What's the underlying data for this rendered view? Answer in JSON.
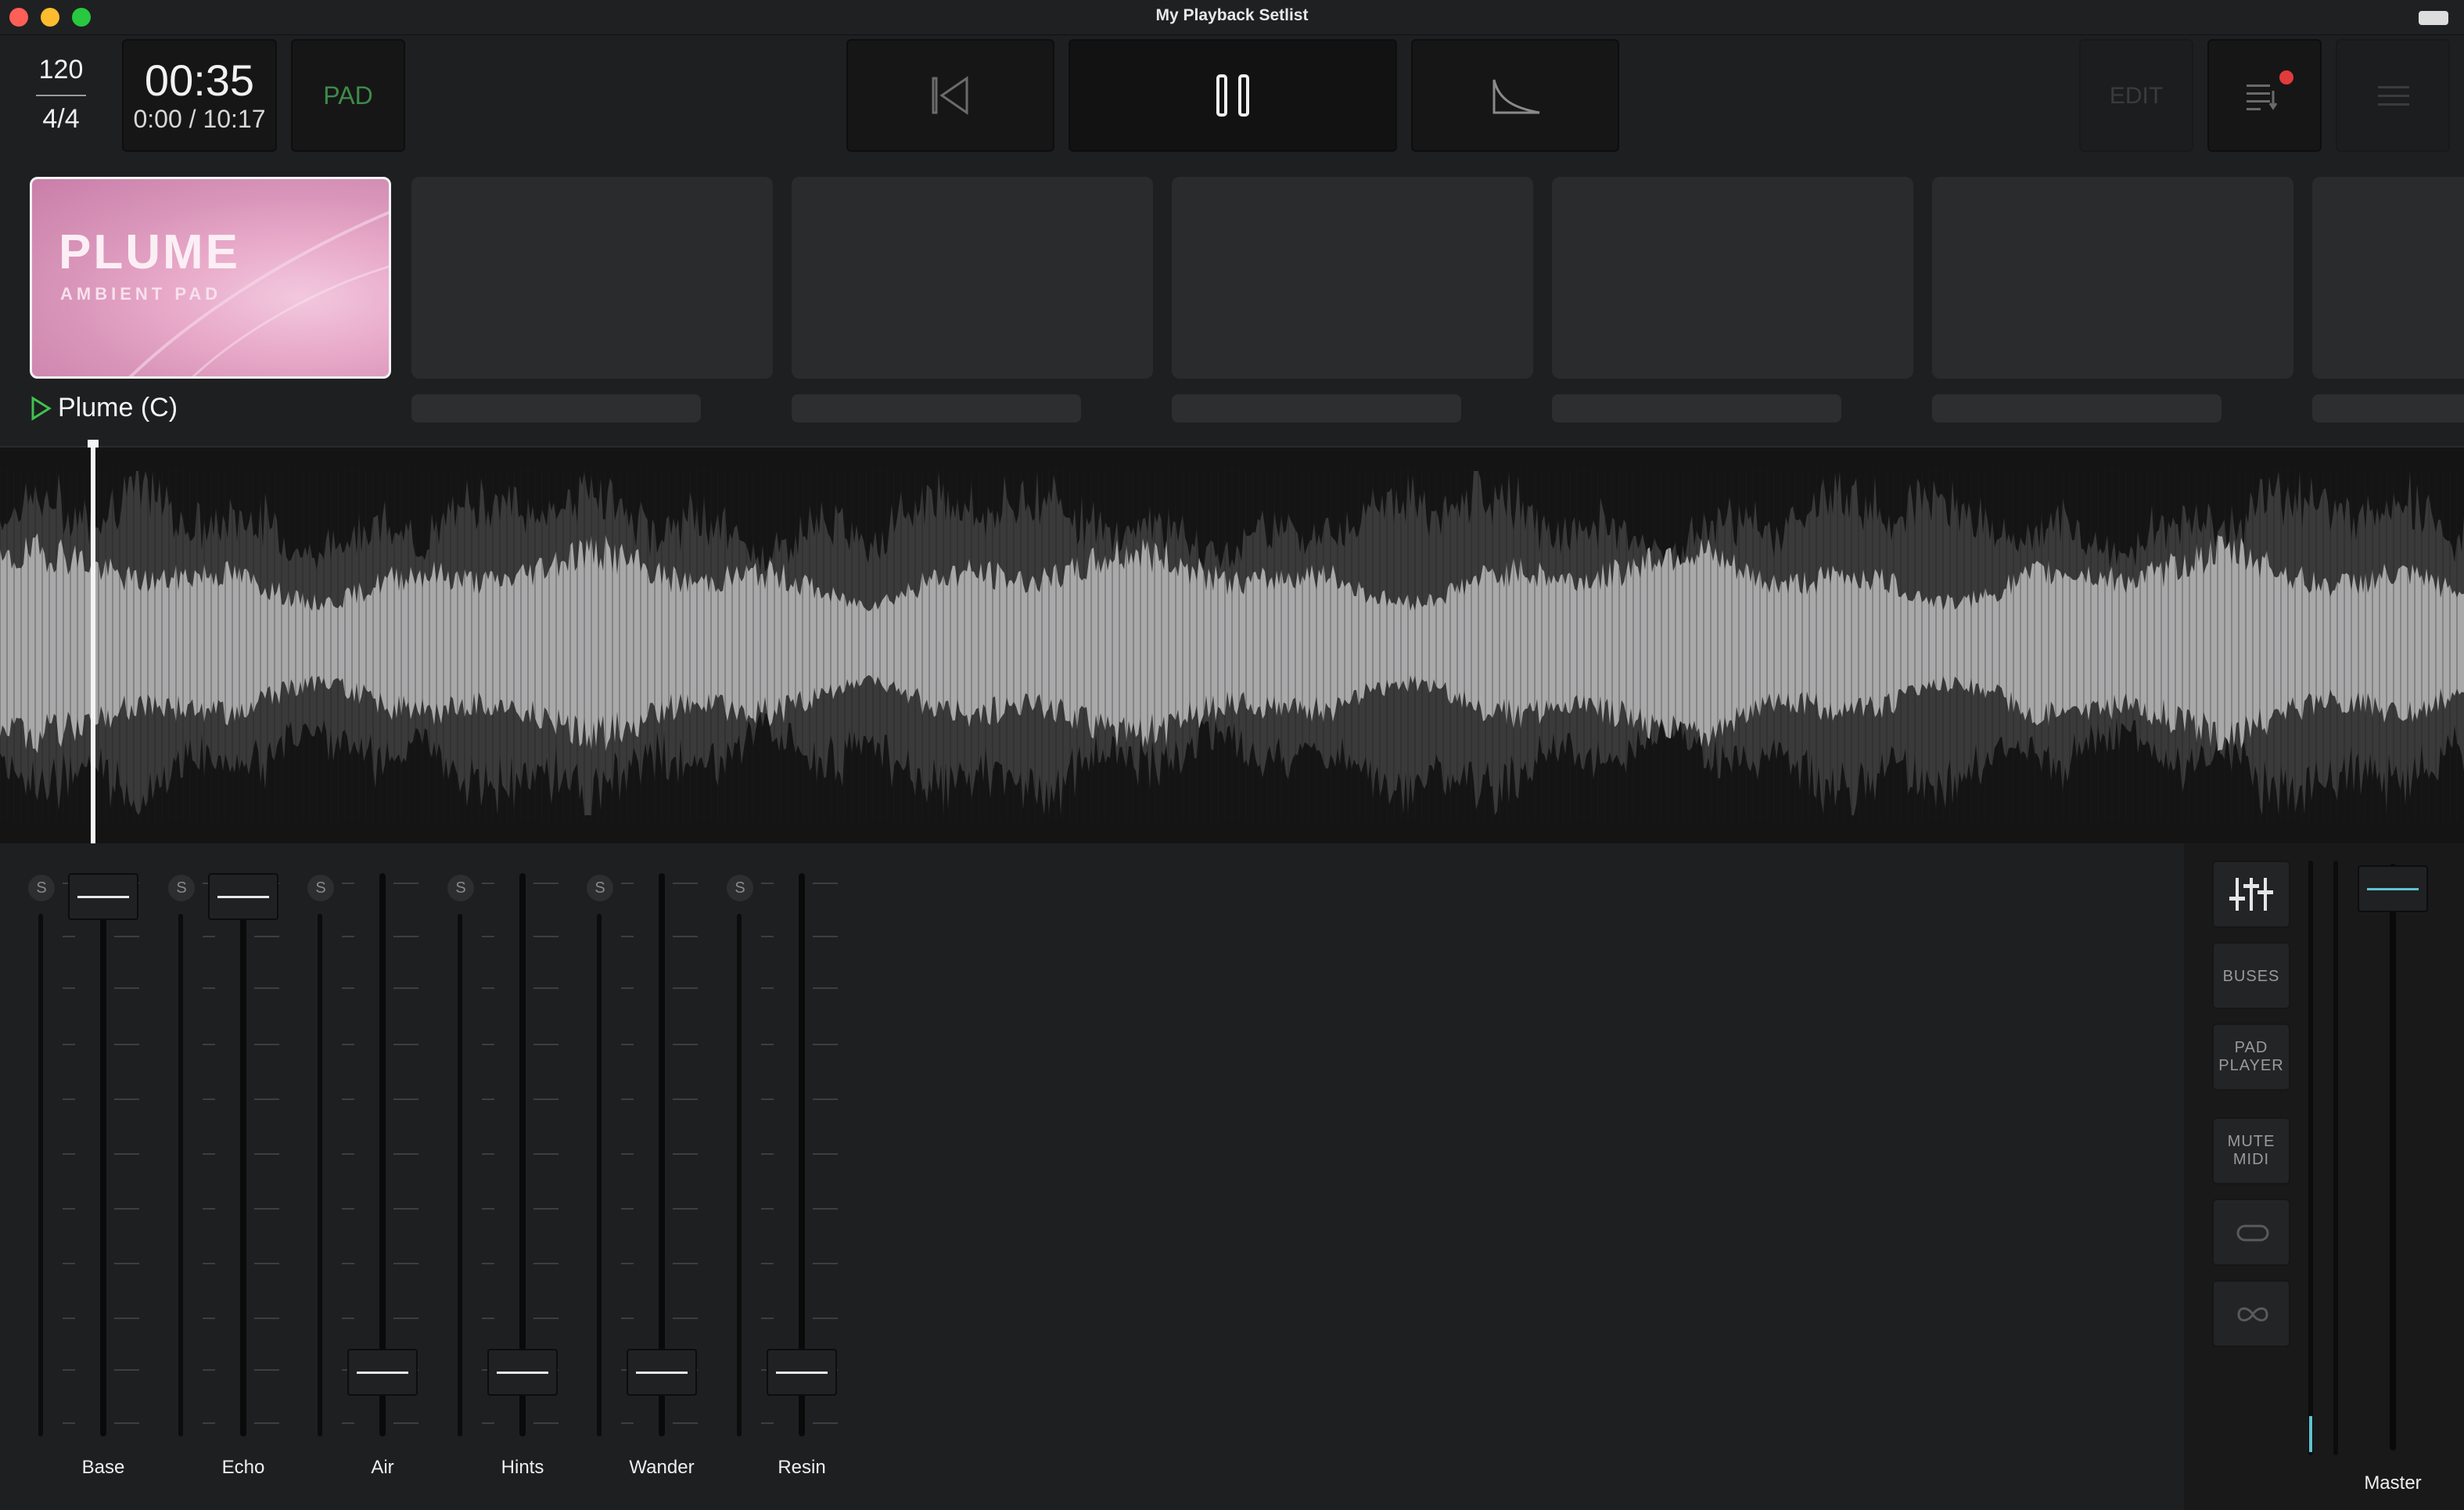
{
  "window": {
    "title": "My Playback Setlist"
  },
  "header": {
    "tempo": "120",
    "time_signature": "4/4",
    "elapsed": "00:35",
    "position": "0:00 / 10:17",
    "pad_label": "PAD",
    "edit_label": "EDIT"
  },
  "pad": {
    "card_title": "PLUME",
    "card_subtitle": "AMBIENT PAD",
    "name": "Plume (C)"
  },
  "mixer": {
    "solo_label": "S",
    "channels": [
      {
        "name": "Base",
        "level": 1.0
      },
      {
        "name": "Echo",
        "level": 1.0
      },
      {
        "name": "Air",
        "level": 0.05
      },
      {
        "name": "Hints",
        "level": 0.05
      },
      {
        "name": "Wander",
        "level": 0.05
      },
      {
        "name": "Resin",
        "level": 0.05
      }
    ],
    "master": {
      "name": "Master",
      "level": 1.0
    }
  },
  "side_panel": {
    "buses": "BUSES",
    "pad_player_1": "PAD",
    "pad_player_2": "PLAYER",
    "mute_midi_1": "MUTE",
    "mute_midi_2": "MIDI"
  },
  "colors": {
    "pad_accent": "#3e8b4a",
    "play_icon": "#3fc24f",
    "notification": "#e23b3b",
    "master_accent": "#5cc4d0"
  }
}
